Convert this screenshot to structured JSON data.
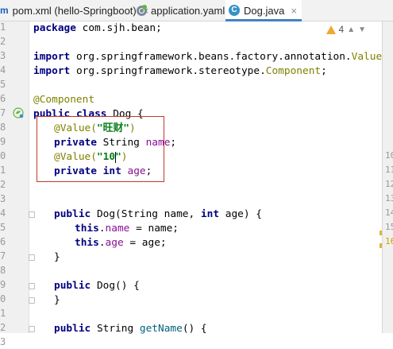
{
  "tabs": [
    {
      "label": "pom.xml (hello-Springboot)",
      "icon": "maven-icon",
      "icon_text": "m",
      "active": false
    },
    {
      "label": "application.yaml",
      "icon": "yaml-icon",
      "active": false
    },
    {
      "label": "Dog.java",
      "icon": "java-class-icon",
      "icon_text": "C",
      "active": true
    }
  ],
  "close_glyph": "×",
  "inspection": {
    "warning_count": "4"
  },
  "gutter_numbers": [
    "1",
    "2",
    "3",
    "4",
    "5",
    "6",
    "7",
    "8",
    "9",
    "0",
    "1",
    "2",
    "3",
    "4",
    "5",
    "6",
    "7",
    "8",
    "9",
    "0",
    "1",
    "2",
    "3"
  ],
  "right_gutter_numbers": [
    "",
    "",
    "",
    "",
    "",
    "",
    "",
    "",
    "",
    "10",
    "11",
    "12",
    "13",
    "14",
    "15",
    "16"
  ],
  "code": {
    "package_kw": "package",
    "package_name": " com.sjh.bean;",
    "import_kw": "import",
    "import1": " org.springframework.beans.factory.annotation.",
    "import1_cls": "Value",
    "import2": " org.springframework.stereotype.",
    "import2_cls": "Component",
    "semicolon": ";",
    "component_ann": "@Component",
    "public_kw": "public",
    "class_kw": "class",
    "class_name": " Dog {",
    "value_ann": "@Value(",
    "name_value": "\"旺财\"",
    "age_value_a": "\"10",
    "age_value_b": "\"",
    "close_paren": ")",
    "private_kw": "private",
    "string_type": " String ",
    "name_field": "name",
    "int_kw": "int",
    "age_field": "age",
    "ctor_sig_a": " Dog(String name, ",
    "ctor_sig_b": " age) {",
    "this_kw": "this",
    "assign_name": " = name;",
    "assign_age": " = age;",
    "close_brace": "}",
    "ctor_empty": " Dog() {",
    "getter_ret": " String ",
    "getter_name": "getName",
    "getter_tail": "() {"
  }
}
